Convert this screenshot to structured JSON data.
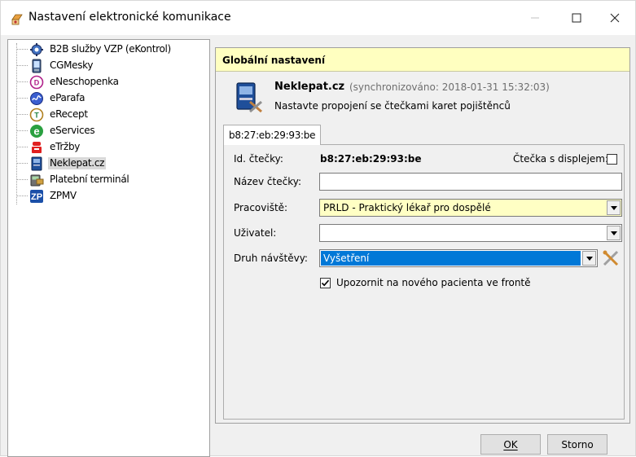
{
  "window": {
    "title": "Nastavení elektronické komunikace"
  },
  "tree": {
    "items": [
      {
        "label": "B2B služby VZP (eKontrol)",
        "icon": "gear-globe-icon"
      },
      {
        "label": "CGMesky",
        "icon": "phone-icon"
      },
      {
        "label": "eNeschopenka",
        "icon": "en-badge-icon"
      },
      {
        "label": "eParafa",
        "icon": "signature-icon"
      },
      {
        "label": "eRecept",
        "icon": "recipe-icon"
      },
      {
        "label": "eServices",
        "icon": "e-services-icon"
      },
      {
        "label": "eTržby",
        "icon": "etrzby-icon"
      },
      {
        "label": "Neklepat.cz",
        "icon": "card-reader-icon",
        "selected": true
      },
      {
        "label": "Platební terminál",
        "icon": "payment-terminal-icon"
      },
      {
        "label": "ZPMV",
        "icon": "zpmv-icon"
      }
    ]
  },
  "panel": {
    "header": "Globální nastavení",
    "service_name": "Neklepat.cz",
    "sync_info": "(synchronizováno: 2018-01-31 15:32:03)",
    "description": "Nastavte propojení se čtečkami karet pojištěnců",
    "tab_label": "b8:27:eb:29:93:be"
  },
  "form": {
    "reader_id_label": "Id. čtečky:",
    "reader_id_value": "b8:27:eb:29:93:be",
    "display_label": "Čtečka s displejem:",
    "display_checked": false,
    "reader_name_label": "Název čtečky:",
    "reader_name_value": "",
    "workplace_label": "Pracoviště:",
    "workplace_value": "PRLD - Praktický lékař pro dospělé",
    "user_label": "Uživatel:",
    "user_value": "",
    "visit_type_label": "Druh návštěvy:",
    "visit_type_value": "Vyšetření",
    "notify_label": "Upozornit na nového pacienta ve frontě",
    "notify_checked": true
  },
  "buttons": {
    "ok": "OK",
    "cancel": "Storno"
  },
  "colors": {
    "header_bg": "#ffffc0",
    "selection_blue": "#0078d7",
    "workplace_bg": "#ffffc4"
  }
}
